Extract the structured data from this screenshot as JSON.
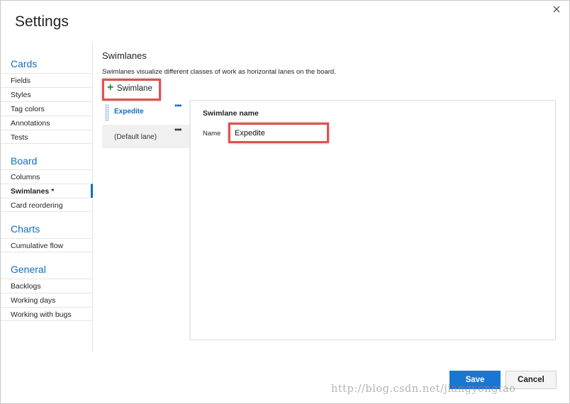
{
  "dialog": {
    "title": "Settings",
    "close_icon": "close-icon"
  },
  "sidebar": {
    "cards": {
      "title": "Cards",
      "items": [
        "Fields",
        "Styles",
        "Tag colors",
        "Annotations",
        "Tests"
      ]
    },
    "board": {
      "title": "Board",
      "items": [
        "Columns",
        "Swimlanes *",
        "Card reordering"
      ],
      "active": "Swimlanes *"
    },
    "charts": {
      "title": "Charts",
      "items": [
        "Cumulative flow"
      ]
    },
    "general": {
      "title": "General",
      "items": [
        "Backlogs",
        "Working days",
        "Working with bugs"
      ]
    }
  },
  "main": {
    "title": "Swimlanes",
    "description": "Swimlanes visualize different classes of work as horizontal lanes on the board.",
    "add_button": {
      "label": "Swimlane",
      "icon": "plus-icon"
    },
    "lanes": [
      {
        "name": "Expedite",
        "menu": "•••"
      },
      {
        "name": "(Default lane)",
        "menu": "•••"
      }
    ],
    "detail": {
      "title": "Swimlane name",
      "name_label": "Name",
      "name_value": "Expedite"
    }
  },
  "footer": {
    "save_label": "Save",
    "cancel_label": "Cancel"
  },
  "watermark": "http://blog.csdn.net/jiangyongtao",
  "colors": {
    "accent": "#106ebe",
    "save_button": "#1976d2",
    "highlight_border": "#e0524e",
    "plus_green": "#1f8a2b"
  }
}
